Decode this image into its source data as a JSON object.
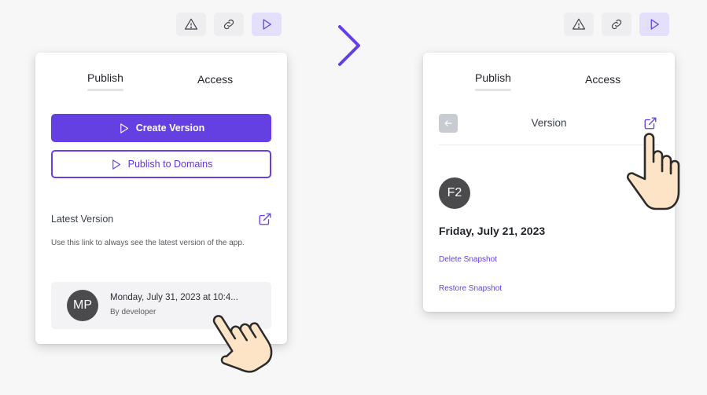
{
  "left_toolbar": {
    "icons": [
      "warning-icon",
      "link-icon",
      "play-icon"
    ]
  },
  "right_toolbar": {
    "icons": [
      "warning-icon",
      "link-icon",
      "play-icon"
    ]
  },
  "left_panel": {
    "tabs": [
      {
        "label": "Publish",
        "active": true
      },
      {
        "label": "Access",
        "active": false
      }
    ],
    "create_version_label": "Create Version",
    "publish_domains_label": "Publish to Domains",
    "latest_version_title": "Latest Version",
    "latest_version_help": "Use this link to always see the latest version of the app.",
    "version_item": {
      "avatar_initials": "MP",
      "title": "Monday, July 31, 2023 at 10:4...",
      "subtitle": "By developer"
    }
  },
  "right_panel": {
    "tabs": [
      {
        "label": "Publish",
        "active": true
      },
      {
        "label": "Access",
        "active": false
      }
    ],
    "header_title": "Version",
    "avatar_initials": "F2",
    "date": "Friday, July 21, 2023",
    "delete_label": "Delete Snapshot",
    "restore_label": "Restore Snapshot"
  },
  "colors": {
    "accent": "#6440e3",
    "avatar_bg": "#4b4b4e",
    "toolbar_bg": "#eeeef1",
    "toolbar_primary_bg": "#e4dffa"
  }
}
